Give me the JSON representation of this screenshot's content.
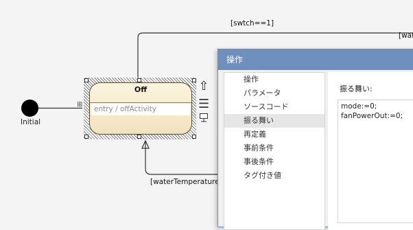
{
  "diagram": {
    "initial_label": "Initial",
    "state": {
      "name": "Off",
      "activity": "entry / offActivity"
    },
    "transitions": {
      "top_label": "[swtch==1]",
      "top_right_label": "[wat",
      "bottom_label": "[waterTemperatureI"
    },
    "tools": {
      "up_icon": "arrow-up",
      "list_icon": "list",
      "stamp_icon": "stamp"
    }
  },
  "dialog": {
    "title": "操作",
    "nav_items": [
      "操作",
      "パラメータ",
      "ソースコード",
      "振る舞い",
      "再定義",
      "事前条件",
      "事後条件",
      "タグ付き値"
    ],
    "selected_index": 3,
    "content_label": "振る舞い:",
    "behavior_text": "mode:=0;\nfanPowerOut:=0;"
  }
}
